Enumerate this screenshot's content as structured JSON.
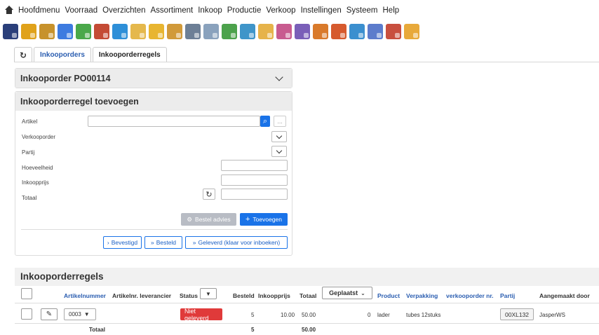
{
  "menu": [
    "Hoofdmenu",
    "Voorraad",
    "Overzichten",
    "Assortiment",
    "Inkoop",
    "Productie",
    "Verkoop",
    "Instellingen",
    "Systeem",
    "Help"
  ],
  "toolbar_icons": [
    {
      "name": "phone-icon",
      "color": "#2a3f7a"
    },
    {
      "name": "folder-icon",
      "color": "#e0a21a"
    },
    {
      "name": "dolly-icon",
      "color": "#c7922c"
    },
    {
      "name": "dashboard-icon",
      "color": "#3d7be0"
    },
    {
      "name": "clipboard-icon",
      "color": "#4aa84a"
    },
    {
      "name": "grid-icon",
      "color": "#c44b35"
    },
    {
      "name": "globe-icon",
      "color": "#2e8fd8"
    },
    {
      "name": "hand-icon",
      "color": "#e5b84c"
    },
    {
      "name": "star-icon",
      "color": "#e8b530"
    },
    {
      "name": "box-icon",
      "color": "#d19a3a"
    },
    {
      "name": "search-icon",
      "color": "#6d7f96"
    },
    {
      "name": "search-list-icon",
      "color": "#8aa2bd"
    },
    {
      "name": "globe-search-icon",
      "color": "#4ca24c"
    },
    {
      "name": "document-globe-icon",
      "color": "#3f95c9"
    },
    {
      "name": "package-icon",
      "color": "#e6b34a"
    },
    {
      "name": "cart-icon",
      "color": "#c85b8f"
    },
    {
      "name": "report-icon",
      "color": "#7a5fb8"
    },
    {
      "name": "truck-icon",
      "color": "#d97a2b"
    },
    {
      "name": "globe-doc-icon",
      "color": "#d65a2e"
    },
    {
      "name": "globe-box-icon",
      "color": "#3b8fcf"
    },
    {
      "name": "globe-pen-icon",
      "color": "#5c7ccc"
    },
    {
      "name": "globe-star-icon",
      "color": "#c84f3f"
    },
    {
      "name": "users-icon",
      "color": "#e8a93a"
    }
  ],
  "tabs": {
    "refresh": "↻",
    "orders": "Inkooporders",
    "order_lines": "Inkooporderregels"
  },
  "order_panel": {
    "title": "Inkooporder PO00114"
  },
  "add_panel": {
    "title": "Inkooporderregel toevoegen",
    "labels": {
      "artikel": "Artikel",
      "verkooporder": "Verkooporder",
      "partij": "Partij",
      "hoeveelheid": "Hoeveelheid",
      "inkoopprijs": "Inkoopprijs",
      "totaal": "Totaal"
    },
    "search_btn": "⌕",
    "more_btn": "...",
    "recalc_btn": "↻",
    "advice_btn": "Bestel advies",
    "add_btn": "Toevoegen",
    "status_buttons": [
      "Bevestigd",
      "Besteld",
      "Geleverd (klaar voor inboeken)"
    ]
  },
  "table": {
    "title": "Inkooporderregels",
    "headers": {
      "artikelnummer": "Artikelnummer",
      "artikelnr_leverancier": "Artikelnr. leverancier",
      "status": "Status",
      "besteld": "Besteld",
      "inkoopprijs": "Inkoopprijs",
      "totaal": "Totaal",
      "geplaatst": "Geplaatst",
      "product": "Product",
      "verpakking": "Verpakking",
      "verkooporder": "verkooporder nr.",
      "partij": "Partij",
      "aangemaakt": "Aangemaakt door"
    },
    "row": {
      "artikel": "0003",
      "status": "Niet geleverd",
      "besteld": "5",
      "inkoopprijs": "10.00",
      "totaal": "50.00",
      "geplaatst": "0",
      "product": "lader",
      "verpakking": "tubes 12stuks",
      "partij": "00XL132",
      "aangemaakt": "JasperWS"
    },
    "footer": {
      "label": "Totaal",
      "besteld": "5",
      "totaal": "50.00"
    }
  }
}
